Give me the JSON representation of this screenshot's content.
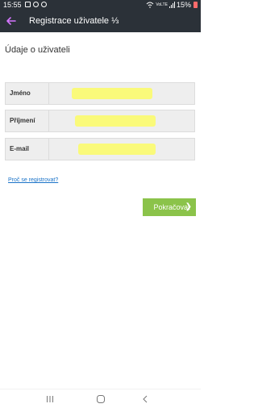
{
  "status": {
    "time": "15:55",
    "signal_text": "VoLTE",
    "battery_text": "15%"
  },
  "app_bar": {
    "title": "Registrace uživatele ⅓"
  },
  "form": {
    "section_title": "Údaje o uživateli",
    "fields": [
      {
        "label": "Jméno",
        "value": ""
      },
      {
        "label": "Příjmení",
        "value": ""
      },
      {
        "label": "E-mail",
        "value": ""
      }
    ],
    "why_link": "Proč se registrovat?",
    "continue_label": "Pokračovat"
  },
  "icons": {
    "back": "arrow-left-icon",
    "continue": "chevron-right-icon",
    "nav_recent": "recent-apps-icon",
    "nav_home": "home-icon",
    "nav_back": "back-icon"
  }
}
